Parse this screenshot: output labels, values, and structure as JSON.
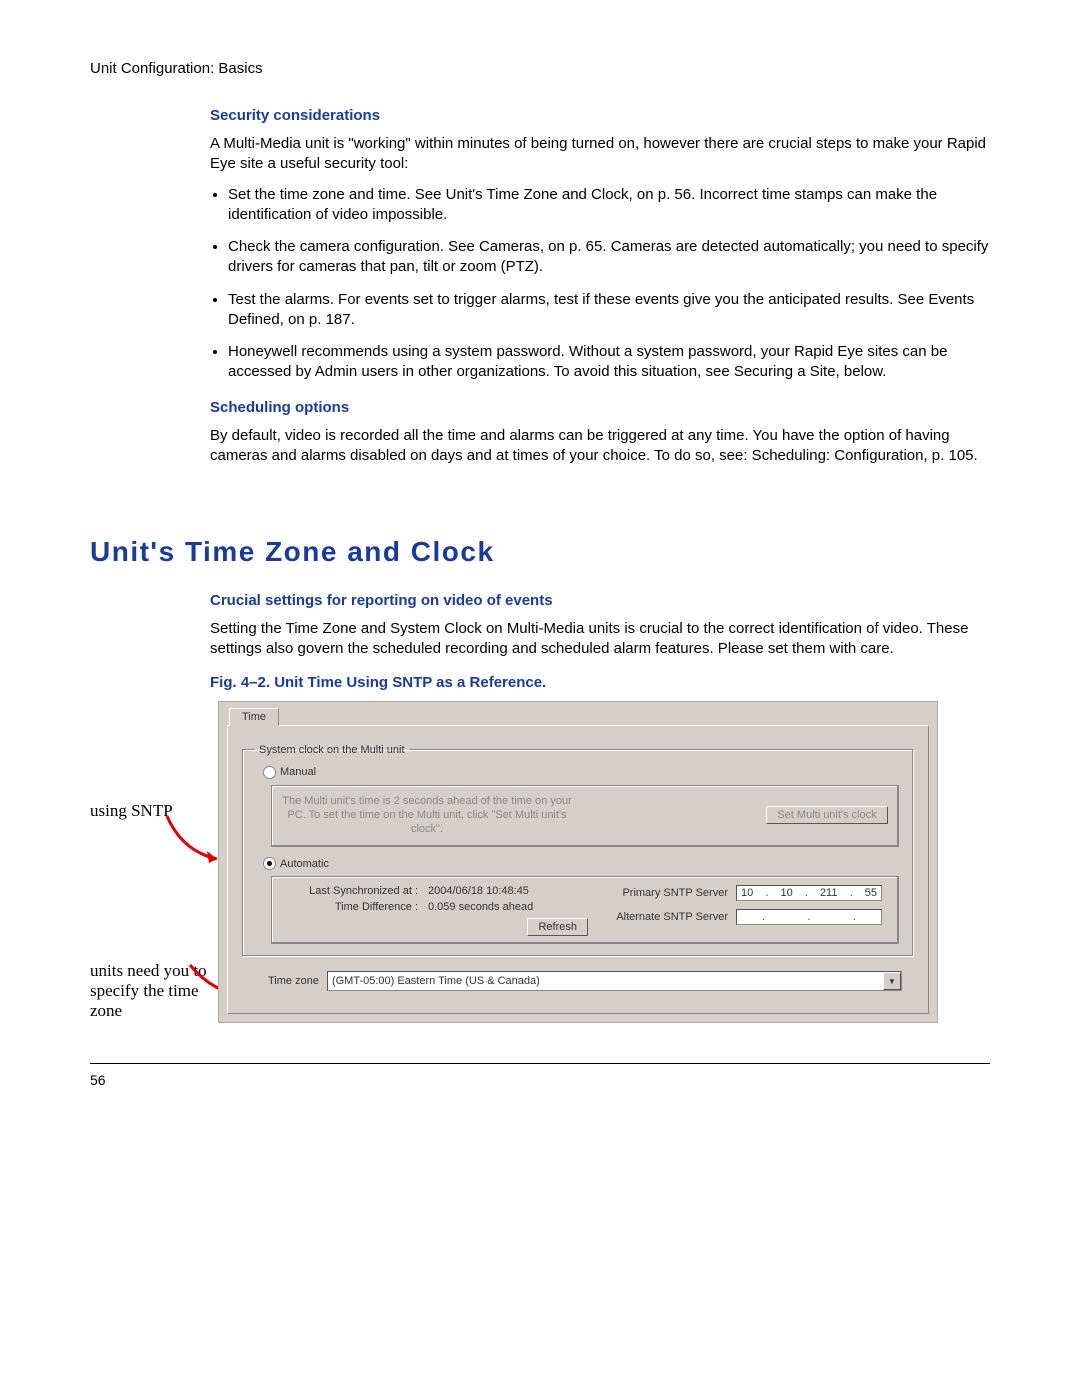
{
  "header": "Unit Configuration: Basics",
  "sec1_title": "Security considerations",
  "sec1_intro": "A Multi-Media unit is \"working\" within minutes of being turned on, however there are  crucial steps to make your Rapid Eye site a useful security tool:",
  "sec1_bullets": [
    "Set the time zone and time. See Unit's Time Zone and Clock, on p. 56. Incorrect time stamps can make the identification of video impossible.",
    "Check the camera configuration. See Cameras, on p. 65. Cameras are detected automatically; you need to specify drivers for cameras that pan, tilt or zoom (PTZ).",
    "Test the alarms. For events set to trigger alarms, test if these events give you the anticipated results. See Events Defined, on p. 187.",
    "Honeywell recommends using a system password. Without a system password, your Rapid Eye sites can be accessed by Admin users in other organizations. To avoid this situation, see Securing a Site, below."
  ],
  "sec2_title": "Scheduling options",
  "sec2_para": "By default, video is recorded all the time and alarms can be triggered at any time. You have the option of having cameras and alarms disabled on days and at times of your choice. To do so, see: Scheduling: Configuration, p. 105.",
  "main_heading": "Unit's Time Zone and Clock",
  "sec3_title": "Crucial settings for reporting on video of events",
  "sec3_para": "Setting the Time Zone and System Clock on Multi-Media units is crucial to the correct identification of video. These settings also govern the scheduled recording and scheduled alarm features. Please set them with care.",
  "fig_caption": "Fig. 4–2.    Unit Time Using SNTP as a Reference.",
  "annotations": {
    "a1": "using SNTP",
    "a2": "units need you to specify the time zone"
  },
  "panel": {
    "tab": "Time",
    "group_legend": "System clock on the Multi unit",
    "manual_label": "Manual",
    "manual_msg": "The Multi unit's time is 2 seconds ahead of the time on your PC. To set the time on the Multi unit, click \"Set Multi unit's clock\".",
    "manual_btn": "Set Multi unit's clock",
    "auto_label": "Automatic",
    "last_sync_label": "Last Synchronized at :",
    "last_sync_val": "2004/06/18 10:48:45",
    "time_diff_label": "Time Difference :",
    "time_diff_val": "0.059 seconds ahead",
    "refresh_btn": "Refresh",
    "primary_label": "Primary SNTP Server",
    "primary_ip": [
      "10",
      "10",
      "211",
      "55"
    ],
    "alt_label": "Alternate SNTP Server",
    "alt_ip": [
      "",
      "",
      "",
      ""
    ],
    "tz_label": "Time zone",
    "tz_value": "(GMT-05:00) Eastern Time (US & Canada)"
  },
  "page_num": "56"
}
